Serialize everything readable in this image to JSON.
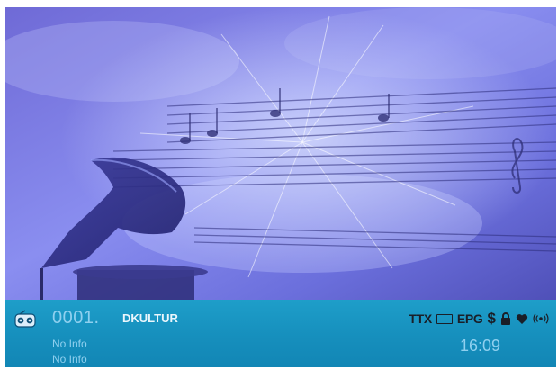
{
  "channel": {
    "number": "0001.",
    "name": "DKULTUR",
    "type_icon": "radio-icon"
  },
  "epg": {
    "now": "No Info",
    "next": "No Info"
  },
  "status_icons": {
    "ttx": "TTX",
    "subtitle_icon": "subtitle-icon",
    "epg": "EPG",
    "pay": "$",
    "lock_icon": "lock-icon",
    "favorite_icon": "heart-icon",
    "signal_icon": "broadcast-icon"
  },
  "clock": "16:09",
  "colors": {
    "bar": "#1a94c2",
    "accent_text": "#8fd0ef",
    "artwork_tint": "#6a63c8"
  }
}
